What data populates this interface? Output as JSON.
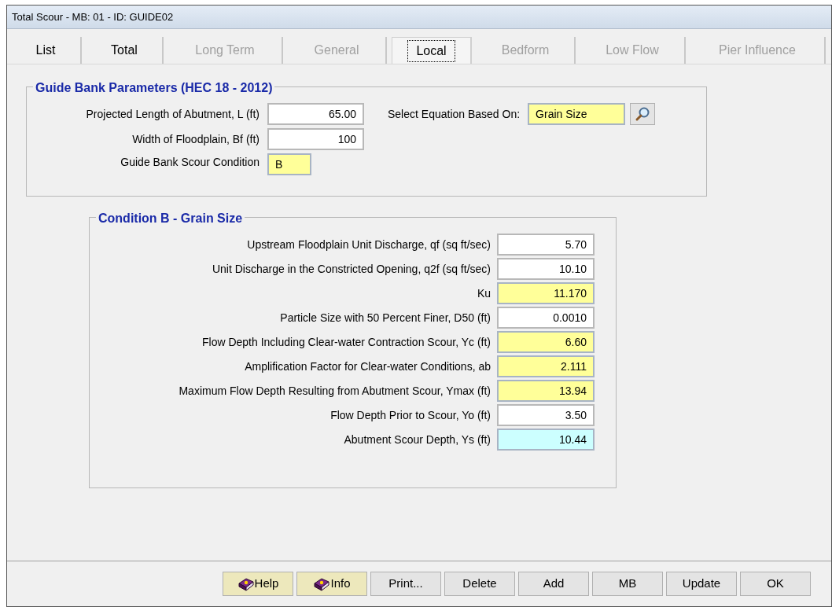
{
  "window": {
    "title": "Total Scour - MB: 01 - ID: GUIDE02"
  },
  "tabs": [
    {
      "label": "List",
      "selected": false,
      "disabled": false
    },
    {
      "label": "Total",
      "selected": false,
      "disabled": false
    },
    {
      "label": "Long Term",
      "selected": false,
      "disabled": true
    },
    {
      "label": "General",
      "selected": false,
      "disabled": true
    },
    {
      "label": "Local",
      "selected": true,
      "disabled": false
    },
    {
      "label": "Bedform",
      "selected": false,
      "disabled": true
    },
    {
      "label": "Low Flow",
      "selected": false,
      "disabled": true
    },
    {
      "label": "Pier Influence",
      "selected": false,
      "disabled": true
    }
  ],
  "guide_bank": {
    "title": "Guide Bank Parameters (HEC 18 - 2012)",
    "fields": [
      {
        "label": "Projected Length of Abutment, L (ft)",
        "value": "65.00",
        "kind": "input"
      },
      {
        "label": "Width of Floodplain, Bf (ft)",
        "value": "100",
        "kind": "input"
      }
    ],
    "condition": {
      "label": "Guide Bank Scour Condition",
      "value": "B",
      "kind": "computed"
    },
    "equation": {
      "label": "Select Equation Based On:",
      "value": "Grain Size",
      "kind": "computed"
    }
  },
  "condition_group": {
    "title": "Condition B - Grain Size",
    "fields": [
      {
        "label": "Upstream Floodplain Unit Discharge, qf (sq ft/sec)",
        "value": "5.70",
        "kind": "input"
      },
      {
        "label": "Unit Discharge in the Constricted Opening, q2f (sq ft/sec)",
        "value": "10.10",
        "kind": "input"
      },
      {
        "label": "Ku",
        "value": "11.170",
        "kind": "computed"
      },
      {
        "label": "Particle Size with 50 Percent Finer, D50 (ft)",
        "value": "0.0010",
        "kind": "input"
      },
      {
        "label": "Flow Depth Including Clear-water Contraction Scour, Yc (ft)",
        "value": "6.60",
        "kind": "computed"
      },
      {
        "label": "Amplification Factor for Clear-water Conditions, ab",
        "value": "2.111",
        "kind": "computed"
      },
      {
        "label": "Maximum Flow Depth Resulting from Abutment Scour, Ymax (ft)",
        "value": "13.94",
        "kind": "computed"
      },
      {
        "label": "Flow Depth Prior to Scour, Yo (ft)",
        "value": "3.50",
        "kind": "input"
      },
      {
        "label": "Abutment Scour Depth, Ys (ft)",
        "value": "10.44",
        "kind": "result"
      }
    ]
  },
  "buttons": [
    {
      "label": "Help",
      "kind": "help"
    },
    {
      "label": "Info",
      "kind": "help"
    },
    {
      "label": "Print...",
      "kind": "plain"
    },
    {
      "label": "Delete",
      "kind": "plain"
    },
    {
      "label": "Add",
      "kind": "plain"
    },
    {
      "label": "MB",
      "kind": "plain"
    },
    {
      "label": "Update",
      "kind": "plain"
    },
    {
      "label": "OK",
      "kind": "plain"
    }
  ]
}
